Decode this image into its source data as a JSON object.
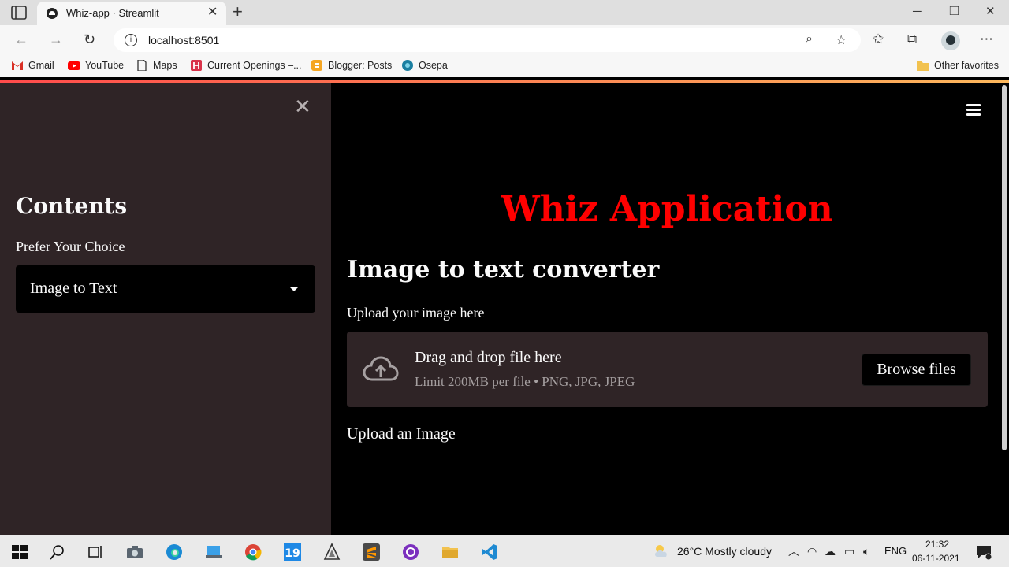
{
  "browser": {
    "tab_title": "Whiz-app · Streamlit",
    "url": "localhost:8501",
    "bookmarks": [
      {
        "label": "Gmail",
        "icon": "gmail-icon"
      },
      {
        "label": "YouTube",
        "icon": "youtube-icon"
      },
      {
        "label": "Maps",
        "icon": "maps-icon"
      },
      {
        "label": "Current Openings –...",
        "icon": "current-openings-icon"
      },
      {
        "label": "Blogger: Posts",
        "icon": "blogger-icon"
      },
      {
        "label": "Osepa",
        "icon": "osepa-icon"
      }
    ],
    "other_favorites": "Other favorites"
  },
  "sidebar": {
    "heading": "Contents",
    "select_label": "Prefer Your Choice",
    "selected_value": "Image to Text"
  },
  "main": {
    "title": "Whiz Application",
    "subtitle": "Image to text converter",
    "uploader_label": "Upload your image here",
    "dropzone_title": "Drag and drop file here",
    "dropzone_limit": "Limit 200MB per file • PNG, JPG, JPEG",
    "browse_button": "Browse files",
    "status_text": "Upload an Image"
  },
  "taskbar": {
    "weather": "26°C  Mostly cloudy",
    "language": "ENG",
    "time": "21:32",
    "date": "06-11-2021"
  },
  "colors": {
    "title_red": "#ff0000",
    "sidebar_bg": "#2f2426",
    "main_bg": "#000000",
    "accent": "#ff4b4b"
  }
}
